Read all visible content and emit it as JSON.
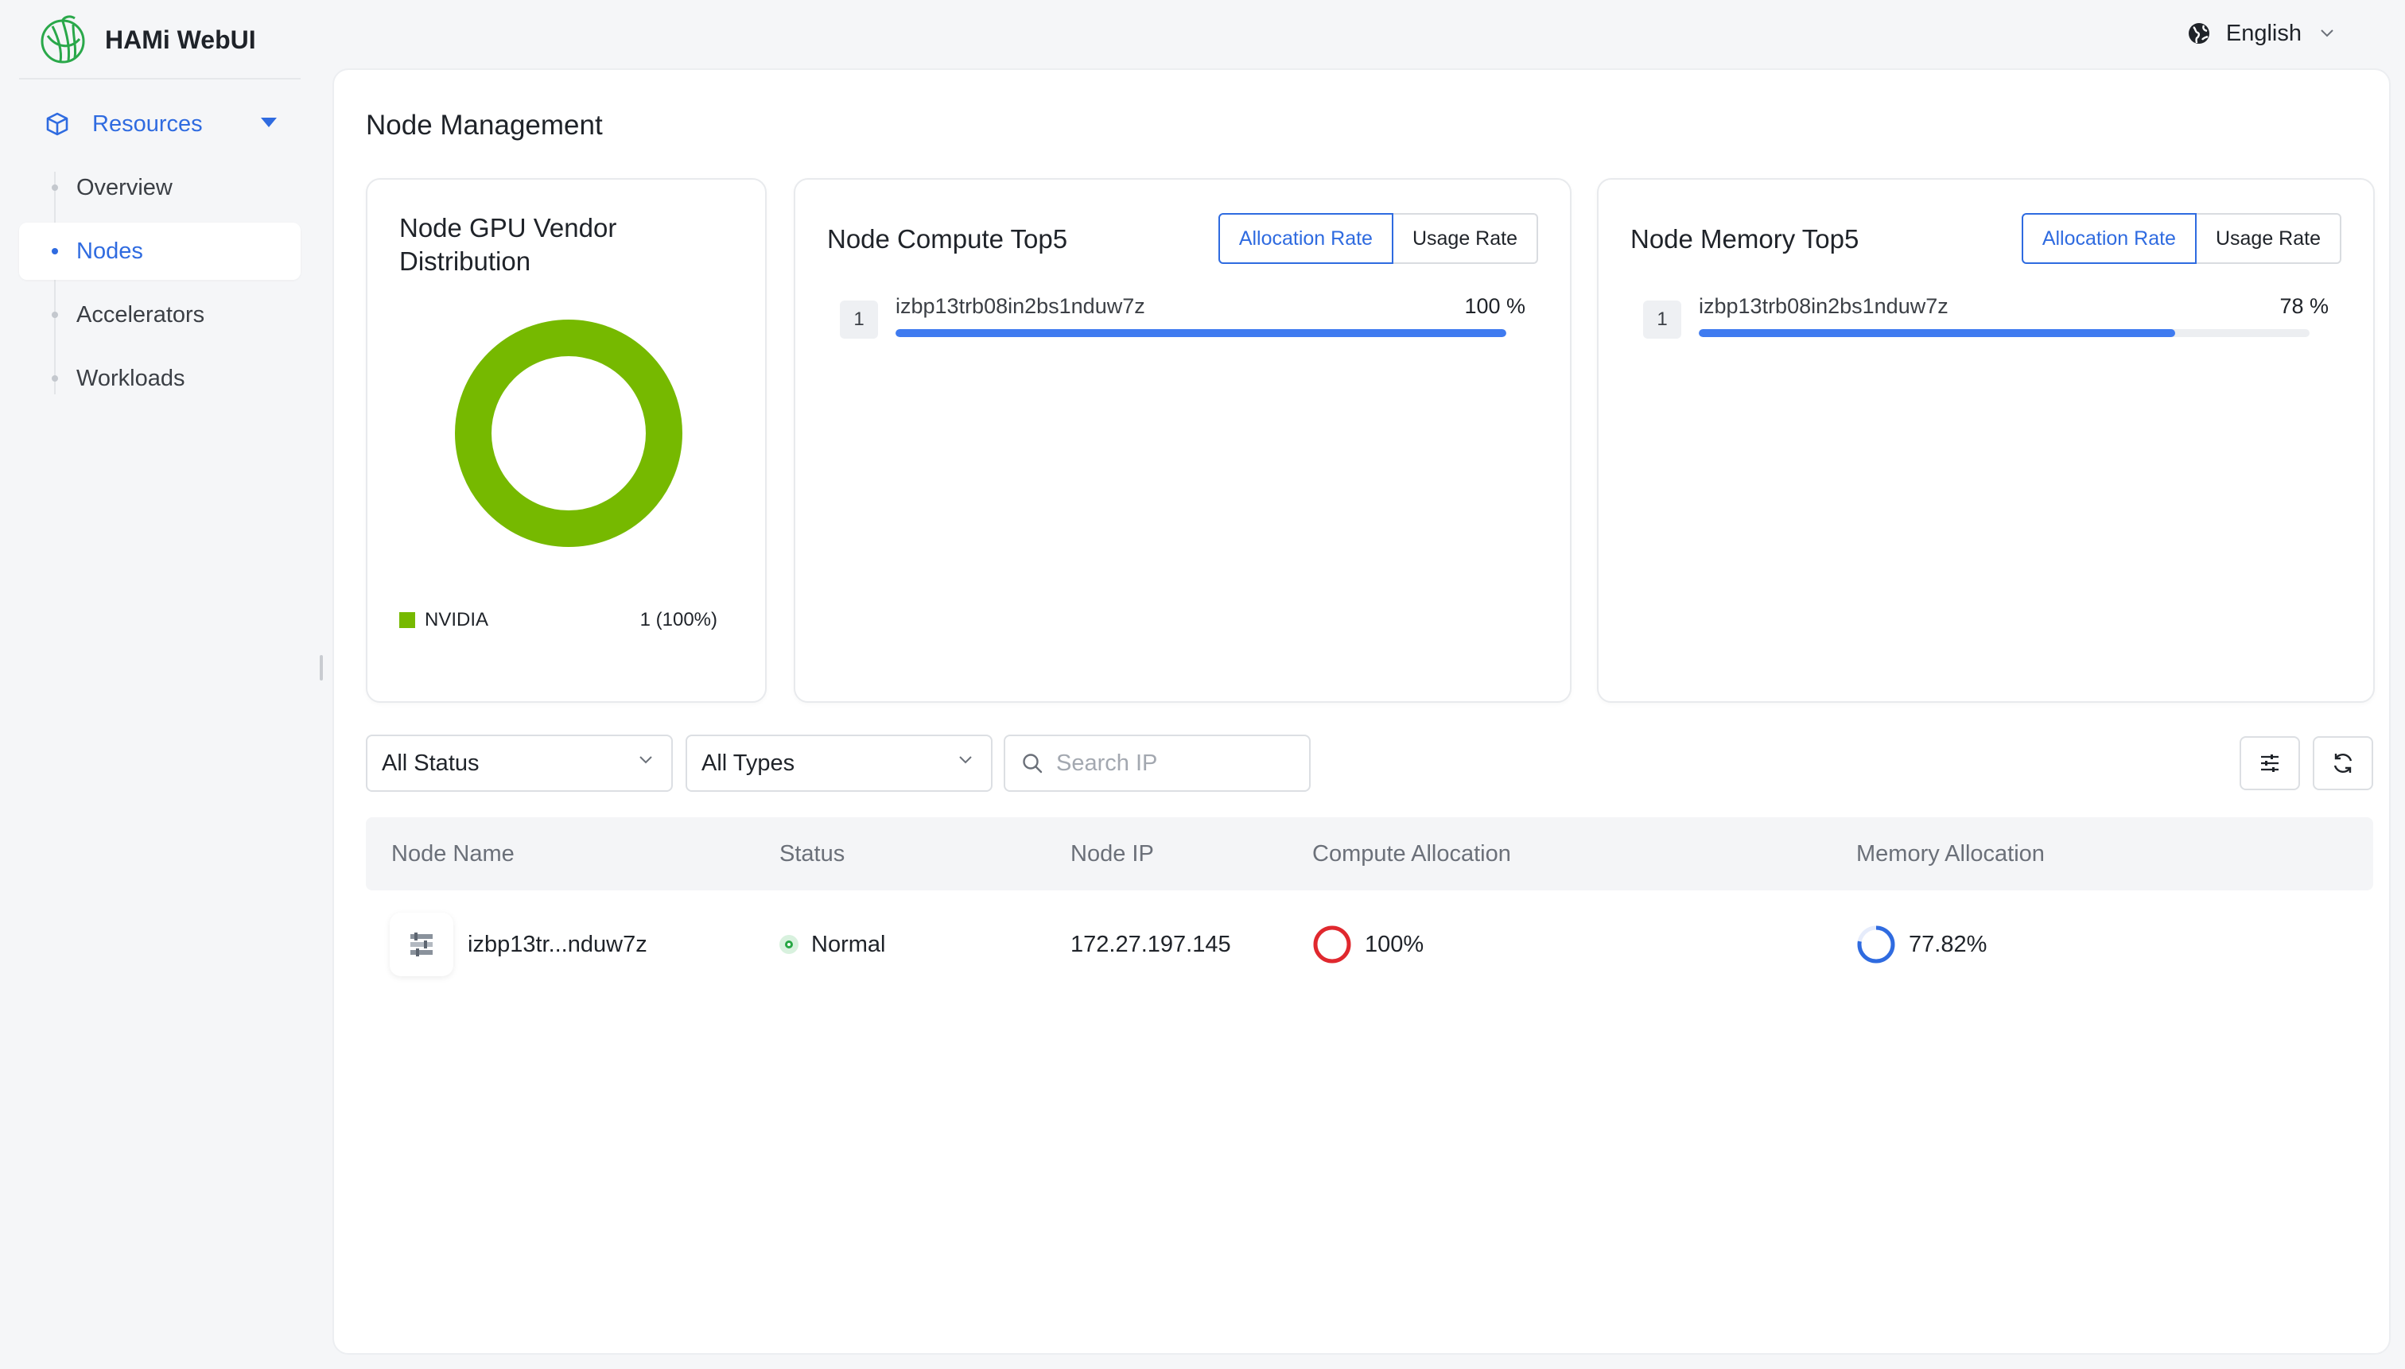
{
  "app": {
    "name": "HAMi WebUI"
  },
  "header": {
    "language": "English"
  },
  "sidebar": {
    "group_label": "Resources",
    "items": [
      {
        "label": "Overview",
        "active": false
      },
      {
        "label": "Nodes",
        "active": true
      },
      {
        "label": "Accelerators",
        "active": false
      },
      {
        "label": "Workloads",
        "active": false
      }
    ]
  },
  "page": {
    "title": "Node Management"
  },
  "vendor_panel": {
    "title": "Node GPU Vendor Distribution",
    "legend": [
      {
        "name": "NVIDIA",
        "value": "1 (100%)",
        "color": "#76b900"
      }
    ]
  },
  "compute_panel": {
    "title": "Node Compute Top5",
    "toggle": {
      "allocation": "Allocation Rate",
      "usage": "Usage Rate",
      "selected": "allocation"
    },
    "rows": [
      {
        "rank": "1",
        "name": "izbp13trb08in2bs1nduw7z",
        "value_text": "100 %",
        "percent": 100
      }
    ]
  },
  "memory_panel": {
    "title": "Node Memory Top5",
    "toggle": {
      "allocation": "Allocation Rate",
      "usage": "Usage Rate",
      "selected": "allocation"
    },
    "rows": [
      {
        "rank": "1",
        "name": "izbp13trb08in2bs1nduw7z",
        "value_text": "78 %",
        "percent": 78
      }
    ]
  },
  "filters": {
    "status": "All Status",
    "type": "All Types",
    "search_placeholder": "Search IP"
  },
  "table": {
    "headers": [
      "Node Name",
      "Status",
      "Node IP",
      "Compute Allocation",
      "Memory Allocation"
    ],
    "rows": [
      {
        "name": "izbp13tr...nduw7z",
        "status": "Normal",
        "ip": "172.27.197.145",
        "compute": "100%",
        "compute_percent": 100,
        "memory": "77.82%",
        "memory_percent": 77.82
      }
    ]
  },
  "colors": {
    "accent": "#2f6be0",
    "nvidia_green": "#76b900",
    "progress_blue": "#3f7bf0",
    "compute_ring": "#e0282e",
    "memory_ring": "#2f6be0",
    "status_ok": "#27a744"
  },
  "icons": {
    "logo": "hami-logo-icon",
    "language": "globe-icon",
    "resources": "cube-icon",
    "search": "search-icon",
    "column_settings": "sliders-icon",
    "refresh": "refresh-icon",
    "node": "server-node-icon"
  }
}
